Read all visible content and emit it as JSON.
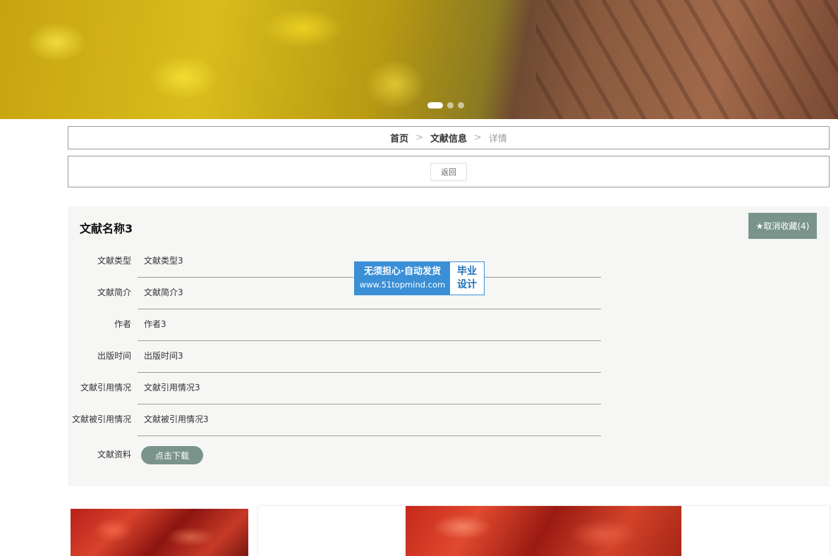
{
  "breadcrumb": {
    "home": "首页",
    "section": "文献信息",
    "current": "详情",
    "separator": ">"
  },
  "back_label": "返回",
  "detail": {
    "title": "文献名称3",
    "favorite_label": "★取消收藏(4)",
    "fields": [
      {
        "label": "文献类型",
        "value": "文献类型3"
      },
      {
        "label": "文献简介",
        "value": "文献简介3"
      },
      {
        "label": "作者",
        "value": "作者3"
      },
      {
        "label": "出版时间",
        "value": "出版时间3"
      },
      {
        "label": "文献引用情况",
        "value": "文献引用情况3"
      },
      {
        "label": "文献被引用情况",
        "value": "文献被引用情况3"
      }
    ],
    "attachment": {
      "label": "文献资料",
      "button": "点击下载"
    }
  },
  "watermark": {
    "line1": "无须担心·自动发货",
    "url": "www.51topmind.com",
    "tag1": "毕业",
    "tag2": "设计"
  }
}
